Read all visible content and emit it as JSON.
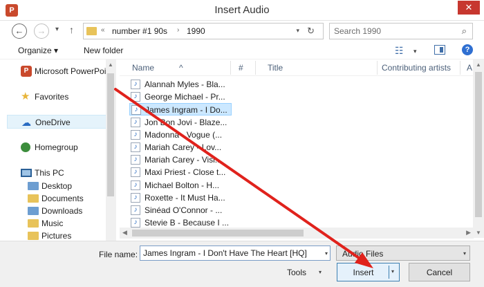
{
  "window": {
    "title": "Insert Audio",
    "app_icon_letter": "P",
    "close_glyph": "✕"
  },
  "nav": {
    "back_glyph": "←",
    "forward_glyph": "→",
    "recent_glyph": "▾",
    "up_glyph": "↑",
    "breadcrumb_prefix": "«",
    "breadcrumb": [
      "number #1  90s",
      "1990"
    ],
    "crumb_sep": "›",
    "refresh_glyph": "↻",
    "search_placeholder": "Search 1990",
    "search_glyph": "⌕"
  },
  "toolbar": {
    "organize_label": "Organize ▾",
    "new_folder_label": "New folder",
    "view_glyph": "☷",
    "view_drop_glyph": "▾",
    "help_glyph": "?"
  },
  "sidebar": {
    "items": [
      {
        "label": "Microsoft PowerPoint",
        "icon": "powerpoint-icon",
        "glyph": "P"
      },
      {
        "label": "Favorites",
        "icon": "star-icon",
        "glyph": "★"
      },
      {
        "label": "OneDrive",
        "icon": "cloud-icon",
        "glyph": "☁"
      },
      {
        "label": "Homegroup",
        "icon": "homegroup-icon",
        "glyph": ""
      },
      {
        "label": "This PC",
        "icon": "computer-icon",
        "glyph": ""
      },
      {
        "label": "Desktop",
        "icon": "folder-icon",
        "glyph": ""
      },
      {
        "label": "Documents",
        "icon": "folder-icon",
        "glyph": ""
      },
      {
        "label": "Downloads",
        "icon": "folder-icon",
        "glyph": ""
      },
      {
        "label": "Music",
        "icon": "folder-icon",
        "glyph": ""
      },
      {
        "label": "Pictures",
        "icon": "folder-icon",
        "glyph": ""
      }
    ]
  },
  "columns": {
    "name": "Name",
    "number": "#",
    "title": "Title",
    "artists": "Contributing artists",
    "extra": "A"
  },
  "files": [
    "Alannah Myles - Bla...",
    "George Michael - Pr...",
    "James Ingram - I Do...",
    "Jon Bon Jovi - Blaze...",
    "Madonna - Vogue (...",
    "Mariah Carey - Lov...",
    "Mariah Carey - Visi...",
    "Maxi Priest - Close t...",
    "Michael Bolton - H...",
    "Roxette - It Must Ha...",
    "Sinéad O'Connor - ...",
    "Stevie B - Because I ..."
  ],
  "file_icon_glyph": "♪",
  "selected_file_index": 2,
  "bottom": {
    "file_name_label": "File name:",
    "file_name_value": "James Ingram - I Don't Have The Heart [HQ]",
    "file_type_value": "Audio Files",
    "tools_label": "Tools",
    "insert_label": "Insert",
    "cancel_label": "Cancel",
    "drop_glyph": "▾"
  },
  "colors": {
    "accent": "#3c7fb1",
    "selection": "#cce8ff",
    "arrow": "#e0221c"
  }
}
